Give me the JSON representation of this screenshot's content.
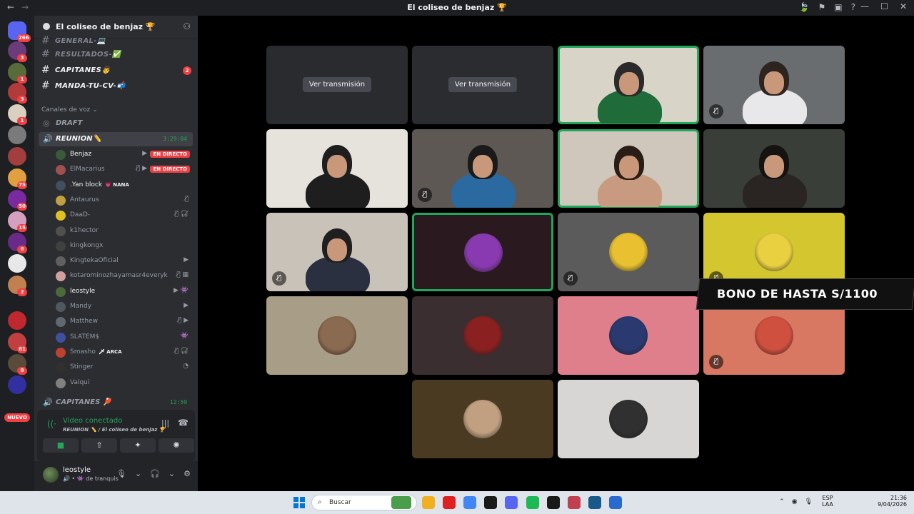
{
  "window": {
    "title": "El coliseo de benjaz 🏆",
    "nav_back": "←",
    "nav_forward": "→",
    "icons": [
      "🍃",
      "⚑",
      "▣",
      "?"
    ],
    "controls": [
      "—",
      "☐",
      "✕"
    ]
  },
  "servers": {
    "items": [
      {
        "badge": "266",
        "color": "#5865f2"
      },
      {
        "badge": "3",
        "color": "#6b3b7a"
      },
      {
        "badge": "1",
        "color": "#5a6b3a"
      },
      {
        "badge": "3",
        "color": "#b33a3a"
      },
      {
        "badge": "1",
        "color": "#d9d0c0"
      },
      {
        "badge": "",
        "color": "#7a7a7a"
      },
      {
        "badge": "",
        "color": "#a33e3e"
      },
      {
        "badge": "75",
        "color": "#e0a040"
      },
      {
        "badge": "50",
        "color": "#7a2aa0"
      },
      {
        "badge": "15",
        "color": "#d4a0c0"
      },
      {
        "badge": "6",
        "color": "#6a2a8a"
      },
      {
        "badge": "",
        "color": "#e8e8e8"
      },
      {
        "badge": "2",
        "color": "#c08050"
      },
      {
        "badge": "",
        "color": "#c0282f"
      },
      {
        "badge": "61",
        "color": "#c04040"
      },
      {
        "badge": "8",
        "color": "#5a4a3a"
      },
      {
        "badge": "",
        "color": "#3030a0"
      }
    ],
    "new_label": "NUEVO"
  },
  "guild": {
    "name": "El coliseo de benjaz 🏆"
  },
  "text_channels": [
    {
      "name": "GENERAL-💻",
      "bright": false,
      "mention": ""
    },
    {
      "name": "RESULTADOS-✅",
      "bright": false,
      "mention": ""
    },
    {
      "name": "CAPITANES👨",
      "bright": true,
      "mention": "2"
    },
    {
      "name": "MANDA-TU-CV-📬",
      "bright": true,
      "mention": ""
    }
  ],
  "voice_category": "Canales de voz ⌄",
  "voice_channels": {
    "draft": "DRAFT",
    "reunion": {
      "name": "REUNION✏️",
      "timer": "3:29:04"
    },
    "capitanes": {
      "name": "CAPITANES 🏓",
      "timer": "12:59"
    }
  },
  "voice_users": [
    {
      "name": "Benjaz",
      "bright": true,
      "live": "EN DIRECTO",
      "icons": "▶",
      "color": "#3a5a3a"
    },
    {
      "name": "ElMacarius",
      "bright": false,
      "live": "EN DIRECTO",
      "icons": "🎙̸ ▶",
      "color": "#a05050"
    },
    {
      "name": ".Yan block",
      "bright": true,
      "tag": "💗 NANA",
      "live": "",
      "icons": "",
      "color": "#405060"
    },
    {
      "name": "Antaurus",
      "bright": false,
      "live": "",
      "icons": "🎙̸",
      "color": "#c0a040"
    },
    {
      "name": "DaaD-",
      "bright": false,
      "live": "",
      "icons": "🎙̸ 🎧̸",
      "color": "#e0c020"
    },
    {
      "name": "k1hector",
      "bright": false,
      "live": "",
      "icons": "",
      "color": "#505050"
    },
    {
      "name": "kingkongx",
      "bright": false,
      "live": "",
      "icons": "",
      "color": "#404040"
    },
    {
      "name": "KingtekaOficial",
      "bright": false,
      "live": "",
      "icons": "▶",
      "color": "#606060"
    },
    {
      "name": "kotarominozhayamasr4everyk",
      "bright": false,
      "live": "",
      "icons": "🎙̸ ▦",
      "color": "#d0a0a0"
    },
    {
      "name": "leostyle",
      "bright": true,
      "live": "",
      "icons": "▶ 👾",
      "color": "#4a6a3a"
    },
    {
      "name": "Mandy",
      "bright": false,
      "live": "",
      "icons": "▶",
      "color": "#505860"
    },
    {
      "name": "Matthew",
      "bright": false,
      "live": "",
      "icons": "🎙̸ ▶",
      "color": "#606870"
    },
    {
      "name": "SLATEM$",
      "bright": false,
      "live": "",
      "icons": "👾",
      "color": "#4050a0"
    },
    {
      "name": "Smasho",
      "bright": false,
      "tag": "🗡 ARCA",
      "live": "",
      "icons": "🎙̸ 🎧̸",
      "color": "#c04030"
    },
    {
      "name": "Stinger",
      "bright": false,
      "live": "",
      "icons": "◔",
      "color": "#303030"
    },
    {
      "name": "Valqui",
      "bright": false,
      "live": "",
      "icons": "",
      "color": "#808080"
    }
  ],
  "connection": {
    "status": "Video conectado",
    "sub": "REUNION ✏️ / El coliseo de benjaz 🏆",
    "buttons": [
      "■",
      "⇧",
      "✦",
      "✺"
    ]
  },
  "user": {
    "name": "leostyle",
    "status": "🔊 • 👾 de tranquis",
    "controls": [
      "🎙",
      "⌄",
      "🎧",
      "⌄",
      "⚙"
    ]
  },
  "tiles": [
    {
      "kind": "stream",
      "watch": "Ver transmisión",
      "bg": "#2a2b2e",
      "speaking": false,
      "mute": false
    },
    {
      "kind": "stream",
      "watch": "Ver transmisión",
      "bg": "#2b2c30",
      "speaking": false,
      "mute": false
    },
    {
      "kind": "cam",
      "bg": "#d9d4c8",
      "person": "#2a2a2a",
      "shirt": "#1f6b3a",
      "speaking": true,
      "mute": false
    },
    {
      "kind": "cam",
      "bg": "#6a6d70",
      "person": "#2d2420",
      "shirt": "#e8e8ea",
      "speaking": false,
      "mute": true
    },
    {
      "kind": "cam",
      "bg": "#e6e2dc",
      "person": "#1e1e1e",
      "shirt": "#1e1e1e",
      "speaking": false,
      "mute": false
    },
    {
      "kind": "cam",
      "bg": "#5d5854",
      "person": "#1a1a1a",
      "shirt": "#2a6aa0",
      "speaking": false,
      "mute": true
    },
    {
      "kind": "cam",
      "bg": "#cfc7bc",
      "person": "#2a1d16",
      "shirt": "#c89a80",
      "speaking": true,
      "mute": false
    },
    {
      "kind": "cam",
      "bg": "#3a3e38",
      "person": "#151311",
      "shirt": "#2a2522",
      "speaking": false,
      "mute": false
    },
    {
      "kind": "cam",
      "bg": "#c9c2b8",
      "person": "#1f1f1f",
      "shirt": "#2a3040",
      "speaking": false,
      "mute": true
    },
    {
      "kind": "avatar",
      "bg": "#2a1a20",
      "avatar": "#8a3ab0",
      "speaking": true,
      "mute": false
    },
    {
      "kind": "avatar",
      "bg": "#5a5b5a",
      "avatar": "#e8c030",
      "speaking": false,
      "mute": true
    },
    {
      "kind": "avatar",
      "bg": "#d4c62e",
      "avatar": "#e8d040",
      "speaking": false,
      "mute": true
    },
    {
      "kind": "avatar",
      "bg": "#a89d86",
      "avatar": "#8a6a50",
      "speaking": false,
      "mute": false
    },
    {
      "kind": "avatar",
      "bg": "#3b2e30",
      "avatar": "#8a2020",
      "speaking": false,
      "mute": false
    },
    {
      "kind": "avatar",
      "bg": "#e07f8c",
      "avatar": "#2a3a70",
      "speaking": false,
      "mute": false
    },
    {
      "kind": "avatar",
      "bg": "#d97862",
      "avatar": "#d05040",
      "speaking": false,
      "mute": true
    },
    {
      "kind": "avatar",
      "bg": "#4a3a22",
      "avatar": "#c0a080",
      "speaking": false,
      "mute": false
    },
    {
      "kind": "avatar",
      "bg": "#d8d6d4",
      "avatar": "#303030",
      "speaking": false,
      "mute": false
    }
  ],
  "promo": "BONO DE HASTA S/1100",
  "taskbar": {
    "search_placeholder": "Buscar",
    "lang_line1": "ESP",
    "lang_line2": "LAA",
    "time": "21:36",
    "date": "9/04/2026",
    "apps": [
      "#4a9d4a",
      "#f0b020",
      "#e02020",
      "#4285f4",
      "#1a1a1a",
      "#5865f2",
      "#1db954",
      "#1a1a1a",
      "#c04050",
      "#1a5a8a",
      "#2a6ad0"
    ]
  }
}
